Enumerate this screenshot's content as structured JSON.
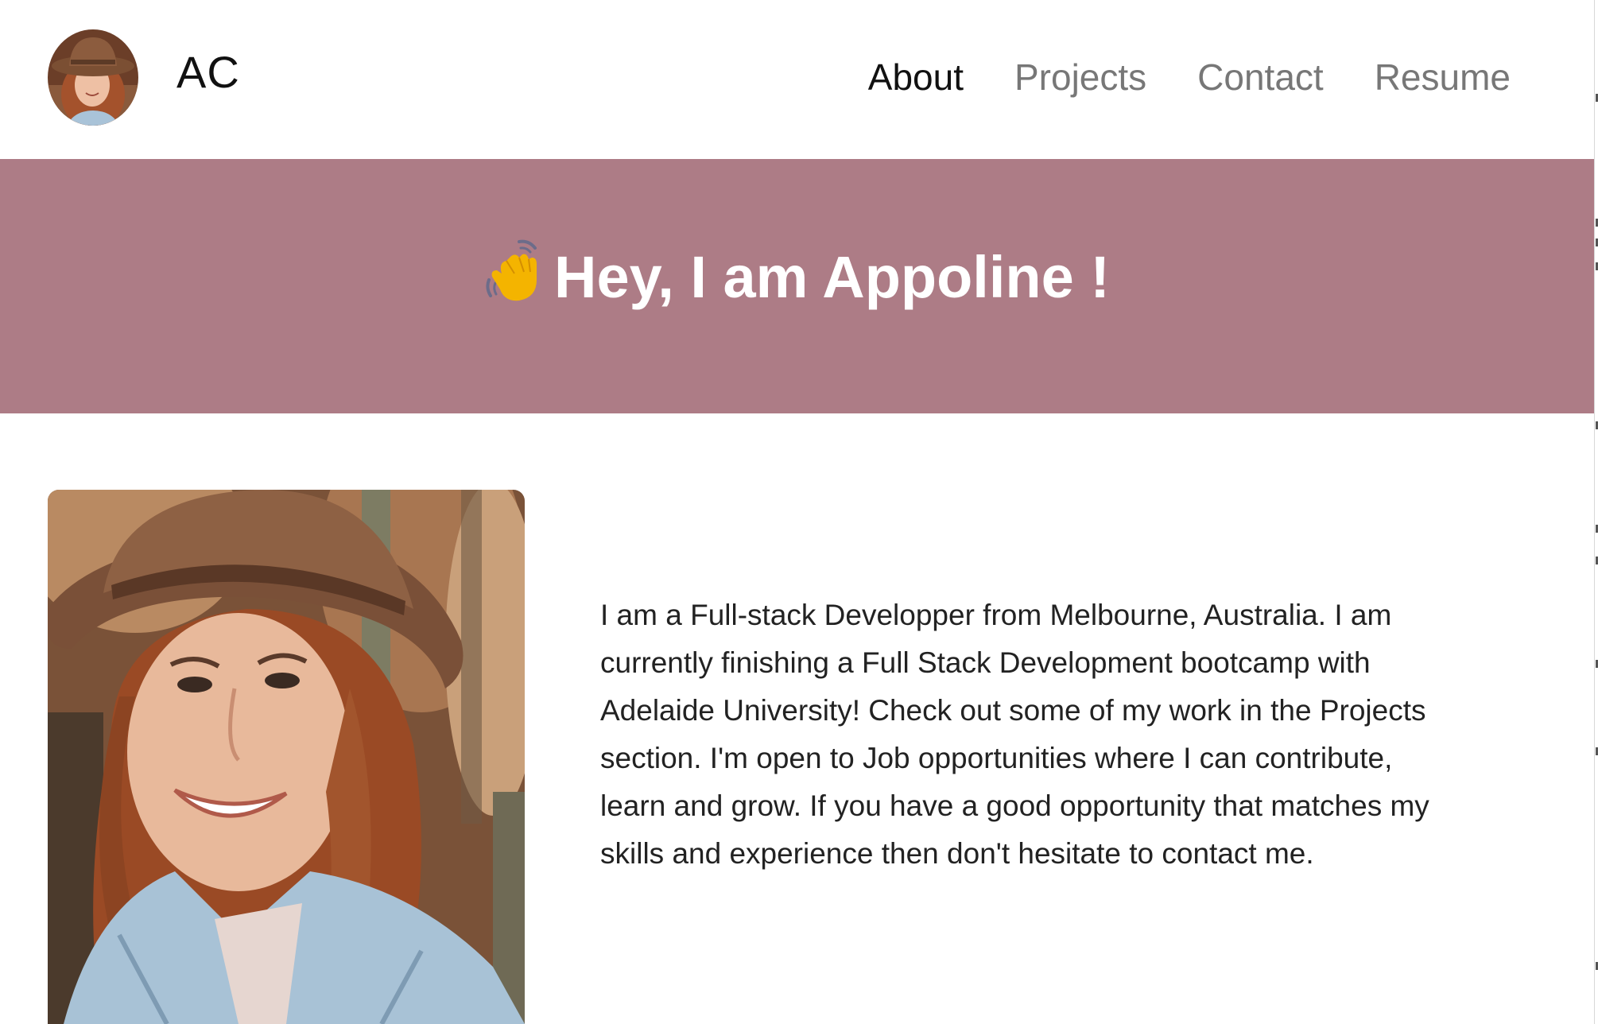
{
  "header": {
    "brand": "AC",
    "nav": [
      {
        "label": "About",
        "active": true
      },
      {
        "label": "Projects",
        "active": false
      },
      {
        "label": "Contact",
        "active": false
      },
      {
        "label": "Resume",
        "active": false
      }
    ]
  },
  "hero": {
    "emoji": "👋",
    "title": "Hey, I am Appoline !"
  },
  "about": {
    "bio": "I am a Full-stack Developper from Melbourne, Australia. I am currently finishing a Full Stack Development bootcamp with Adelaide University! Check out some of my work in the Projects section. I'm open to Job opportunities where I can contribute, learn and grow. If you have a good opportunity that matches my skills and experience then don't hesitate to contact me."
  },
  "colors": {
    "hero_background": "#ad7c86",
    "nav_active": "#111111",
    "nav_inactive": "#777777"
  }
}
